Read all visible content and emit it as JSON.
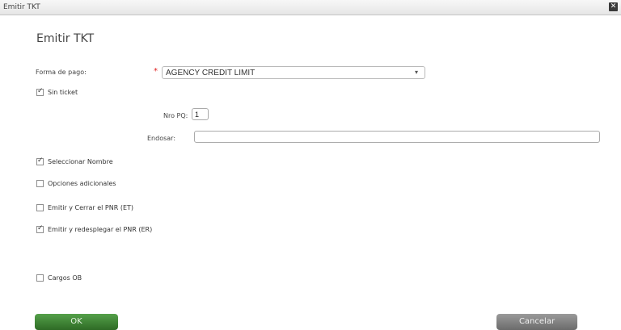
{
  "window": {
    "title": "Emitir TKT",
    "close_label": "✕"
  },
  "dialog": {
    "heading": "Emitir TKT"
  },
  "form": {
    "payment_label": "Forma de pago:",
    "required_mark": "*",
    "payment_value": "AGENCY CREDIT LIMIT",
    "dropdown_arrow": "▾",
    "nro_pq_label": "Nro PQ:",
    "nro_pq_value": "1",
    "endosar_label": "Endosar:",
    "endosar_value": ""
  },
  "checkboxes": {
    "sin_ticket": {
      "label": "Sin ticket",
      "checked": true
    },
    "seleccionar_nombre": {
      "label": "Seleccionar Nombre",
      "checked": true
    },
    "opciones_adicionales": {
      "label": "Opciones adicionales",
      "checked": false
    },
    "emitir_cerrar": {
      "label": "Emitir y Cerrar el PNR (ET)",
      "checked": false
    },
    "emitir_redesplegar": {
      "label": "Emitir y redesplegar el PNR (ER)",
      "checked": true
    },
    "cargos_ob": {
      "label": "Cargos OB",
      "checked": false
    }
  },
  "buttons": {
    "ok": "OK",
    "cancel": "Cancelar"
  }
}
